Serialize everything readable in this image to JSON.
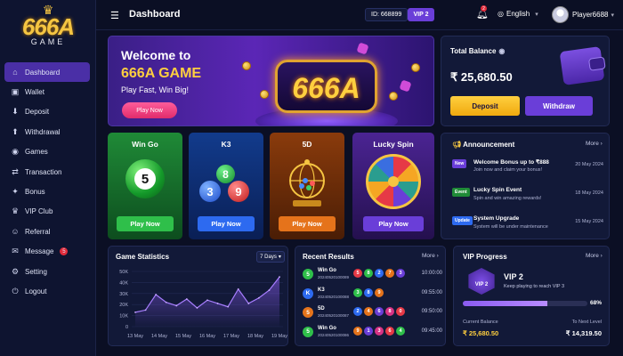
{
  "brand": {
    "name": "666A",
    "sub": "GAME"
  },
  "nav": [
    {
      "label": "Dashboard",
      "icon": "home-icon",
      "glyph": "⌂"
    },
    {
      "label": "Wallet",
      "icon": "wallet-icon",
      "glyph": "▣"
    },
    {
      "label": "Deposit",
      "icon": "deposit-icon",
      "glyph": "⬇"
    },
    {
      "label": "Withdrawal",
      "icon": "withdrawal-icon",
      "glyph": "⬆"
    },
    {
      "label": "Games",
      "icon": "gamepad-icon",
      "glyph": "◉"
    },
    {
      "label": "Transaction",
      "icon": "transaction-icon",
      "glyph": "⇄"
    },
    {
      "label": "Bonus",
      "icon": "gift-icon",
      "glyph": "✦"
    },
    {
      "label": "VIP Club",
      "icon": "crown-icon",
      "glyph": "♛"
    },
    {
      "label": "Referral",
      "icon": "users-icon",
      "glyph": "☺"
    },
    {
      "label": "Message",
      "icon": "message-icon",
      "glyph": "✉",
      "badge": "5"
    },
    {
      "label": "Setting",
      "icon": "gear-icon",
      "glyph": "⚙"
    },
    {
      "label": "Logout",
      "icon": "logout-icon",
      "glyph": "⏻"
    }
  ],
  "topbar": {
    "title": "Dashboard",
    "user_id": "ID: 668899",
    "vip": "VIP 2",
    "notif_count": "2",
    "language": "English",
    "player": "Player6688"
  },
  "welcome": {
    "line1": "Welcome to",
    "line2": "666A GAME",
    "line3": "Play Fast, Win Big!",
    "button": "Play Now",
    "sign": "666A"
  },
  "balance": {
    "title": "Total Balance",
    "amount": "₹ 25,680.50",
    "deposit": "Deposit",
    "withdraw": "Withdraw"
  },
  "games": [
    {
      "title": "Win Go",
      "button": "Play Now"
    },
    {
      "title": "K3",
      "button": "Play Now"
    },
    {
      "title": "5D",
      "button": "Play Now"
    },
    {
      "title": "Lucky Spin",
      "button": "Play Now"
    }
  ],
  "game_art": {
    "wingo_ball": "5",
    "k3_balls": [
      "8",
      "3",
      "9"
    ]
  },
  "announcement": {
    "title": "Announcement",
    "more": "More ›",
    "items": [
      {
        "tag": "New",
        "title": "Welcome Bonus up to ₹888",
        "sub": "Join now and claim your bonus!",
        "date": "20 May 2024"
      },
      {
        "tag": "Event",
        "title": "Lucky Spin Event",
        "sub": "Spin and win amazing rewards!",
        "date": "18 May 2024"
      },
      {
        "tag": "Update",
        "title": "System Upgrade",
        "sub": "System will be under maintenance",
        "date": "15 May 2024"
      }
    ]
  },
  "stats": {
    "title": "Game Statistics",
    "range": "7 Days",
    "chart_data": {
      "type": "area",
      "title": "Game Statistics",
      "x": [
        "13 May",
        "14 May",
        "15 May",
        "16 May",
        "17 May",
        "18 May",
        "19 May"
      ],
      "yticks": [
        "0",
        "10K",
        "20K",
        "30K",
        "40K",
        "50K"
      ],
      "ylim": [
        0,
        50000
      ],
      "values": [
        13000,
        15000,
        29000,
        22000,
        19000,
        25000,
        17000,
        24000,
        21000,
        18000,
        34000,
        21000,
        26000,
        33000,
        45000
      ]
    }
  },
  "recent": {
    "title": "Recent Results",
    "more": "More ›",
    "rows": [
      {
        "badge": "5",
        "game": "Win Go",
        "id": "20240520100089",
        "balls": [
          "5",
          "8",
          "2",
          "7",
          "3"
        ],
        "time": "10:00:00"
      },
      {
        "badge": "K",
        "game": "K3",
        "id": "20240520100088",
        "balls": [
          "3",
          "8",
          "9"
        ],
        "time": "09:55:00"
      },
      {
        "badge": "5",
        "game": "5D",
        "id": "20240520100087",
        "balls": [
          "2",
          "4",
          "6",
          "8",
          "0"
        ],
        "time": "09:50:00"
      },
      {
        "badge": "5",
        "game": "Win Go",
        "id": "20240520100086",
        "balls": [
          "9",
          "1",
          "3",
          "6",
          "4"
        ],
        "time": "09:45:00"
      }
    ]
  },
  "vip_progress": {
    "title": "VIP Progress",
    "more": "More ›",
    "badge": "VIP 2",
    "level": "VIP 2",
    "msg": "Keep playing to reach VIP 3",
    "percent_label": "68%",
    "percent": 68,
    "current_label": "Current Balance",
    "current_value": "₹ 25,680.50",
    "next_label": "To Next Level",
    "next_value": "₹ 14,319.50"
  },
  "colors": {
    "accent": "#6a3ed8",
    "gold": "#ffcf3f",
    "bg": "#0b0f24"
  }
}
